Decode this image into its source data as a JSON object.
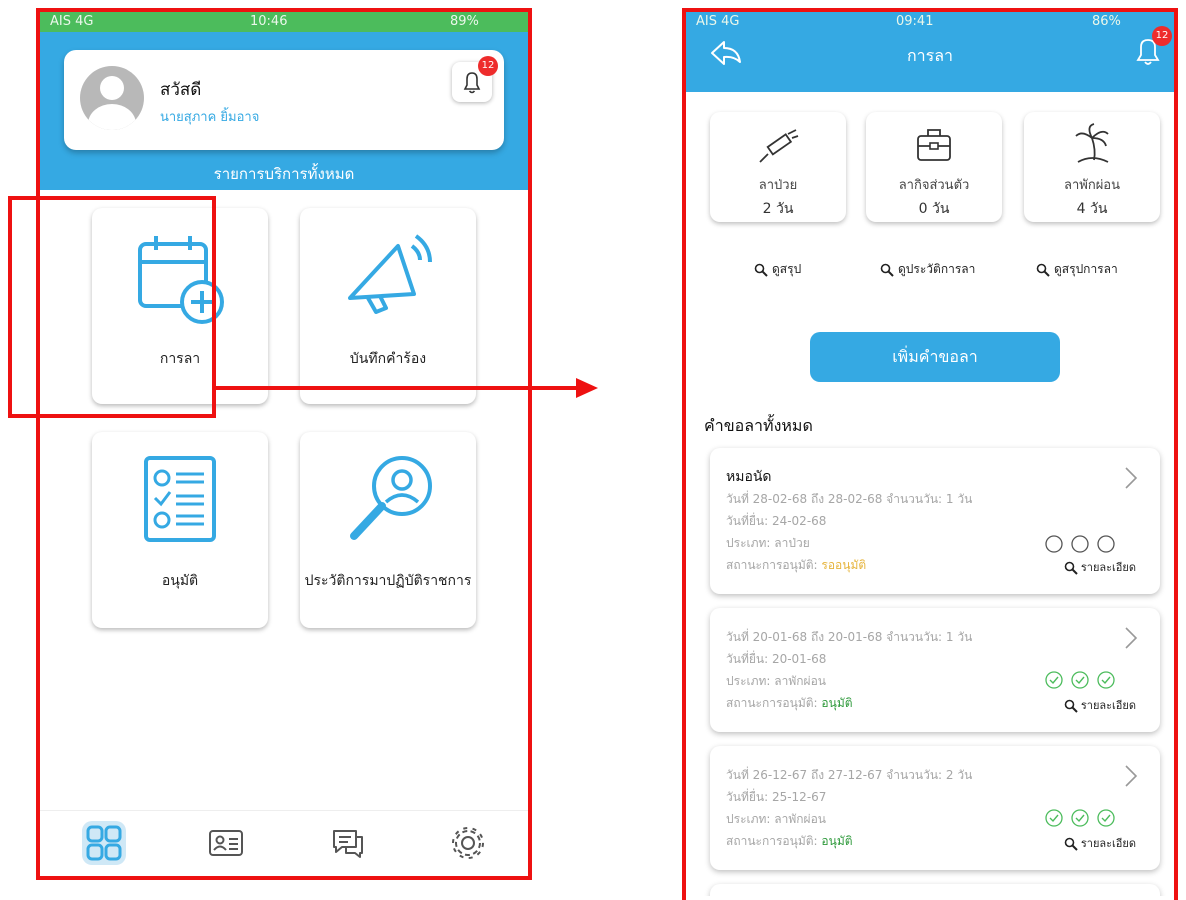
{
  "left": {
    "status": {
      "carrier": "AIS  4G",
      "time": "10:46",
      "battery": "89%"
    },
    "greeting": "สวัสดี",
    "user_name": "นายสุภาค ยิ้มอาจ",
    "notification_count": "12",
    "services_title": "รายการบริการทั้งหมด",
    "tiles": [
      {
        "label": "การลา",
        "icon": "calendar-add-icon"
      },
      {
        "label": "บันทึกคำร้อง",
        "icon": "megaphone-icon"
      },
      {
        "label": "อนุมัติ",
        "icon": "checklist-icon"
      },
      {
        "label": "ประวัติการมาปฏิบัติราชการ",
        "icon": "search-person-icon"
      }
    ],
    "nav": [
      "grid-icon",
      "contact-card-icon",
      "chat-icon",
      "gear-icon"
    ]
  },
  "right": {
    "status": {
      "carrier": "AIS  4G",
      "time": "09:41",
      "battery": "86%"
    },
    "title": "การลา",
    "notification_count": "12",
    "stats": [
      {
        "name": "ลาป่วย",
        "value": "2 วัน",
        "icon": "syringe-icon"
      },
      {
        "name": "ลากิจส่วนตัว",
        "value": "0 วัน",
        "icon": "briefcase-icon"
      },
      {
        "name": "ลาพักผ่อน",
        "value": "4 วัน",
        "icon": "palm-tree-icon"
      }
    ],
    "links": [
      "ดูสรุป",
      "ดูประวัติการลา",
      "ดูสรุปการลา"
    ],
    "add_button": "เพิ่มคำขอลา",
    "requests_title": "คำขอลาทั้งหมด",
    "requests": [
      {
        "heading": "หมอนัด",
        "dates": "วันที่ 28-02-68 ถึง 28-02-68   จำนวนวัน: 1 วัน",
        "submitted": "วันที่ยื่น: 24-02-68",
        "type": "ประเภท: ลาป่วย",
        "status_label": "สถานะการอนุมัติ: ",
        "status": "รออนุมัติ",
        "approvals": "pending",
        "detail": "รายละเอียด"
      },
      {
        "heading": "",
        "dates": "วันที่ 20-01-68 ถึง 20-01-68   จำนวนวัน: 1 วัน",
        "submitted": "วันที่ยื่น: 20-01-68",
        "type": "ประเภท: ลาพักผ่อน",
        "status_label": "สถานะการอนุมัติ: ",
        "status": "อนุมัติ",
        "approvals": "approved",
        "detail": "รายละเอียด"
      },
      {
        "heading": "",
        "dates": "วันที่ 26-12-67 ถึง 27-12-67   จำนวนวัน: 2 วัน",
        "submitted": "วันที่ยื่น: 25-12-67",
        "type": "ประเภท: ลาพักผ่อน",
        "status_label": "สถานะการอนุมัติ: ",
        "status": "อนุมัติ",
        "approvals": "approved",
        "detail": "รายละเอียด"
      }
    ]
  },
  "colors": {
    "primary": "#35a9e3",
    "annotation": "#ee1111",
    "pending": "#e6b43c",
    "approved": "#2f9a3c",
    "check": "#4cbc5c"
  }
}
